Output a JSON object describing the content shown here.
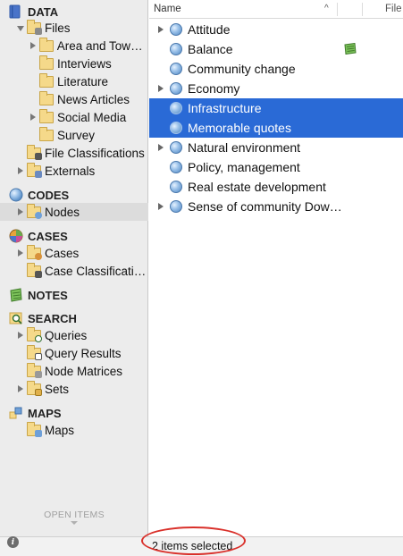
{
  "sidebar": {
    "sections": {
      "data": "DATA",
      "codes": "CODES",
      "cases": "CASES",
      "notes": "NOTES",
      "search": "SEARCH",
      "maps": "MAPS"
    },
    "data_items": {
      "files": "Files",
      "area_and_town": "Area and Town…",
      "interviews": "Interviews",
      "literature": "Literature",
      "news_articles": "News Articles",
      "social_media": "Social Media",
      "survey": "Survey",
      "file_classifications": "File Classifications",
      "externals": "Externals"
    },
    "codes_items": {
      "nodes": "Nodes"
    },
    "cases_items": {
      "cases": "Cases",
      "case_classifications": "Case Classificati…"
    },
    "search_items": {
      "queries": "Queries",
      "query_results": "Query Results",
      "node_matrices": "Node Matrices",
      "sets": "Sets"
    },
    "maps_items": {
      "maps": "Maps"
    },
    "open_items": "OPEN ITEMS",
    "info_icon": "i"
  },
  "list": {
    "columns": {
      "name": "Name",
      "sort_indicator": "^",
      "file": "File"
    },
    "rows": [
      {
        "label": "Attitude",
        "expandable": true,
        "selected": false
      },
      {
        "label": "Balance",
        "expandable": false,
        "selected": false,
        "memo": true
      },
      {
        "label": "Community change",
        "expandable": false,
        "selected": false
      },
      {
        "label": "Economy",
        "expandable": true,
        "selected": false
      },
      {
        "label": "Infrastructure",
        "expandable": false,
        "selected": true
      },
      {
        "label": "Memorable quotes",
        "expandable": false,
        "selected": true
      },
      {
        "label": "Natural environment",
        "expandable": true,
        "selected": false
      },
      {
        "label": "Policy, management",
        "expandable": false,
        "selected": false
      },
      {
        "label": "Real estate development",
        "expandable": false,
        "selected": false
      },
      {
        "label": "Sense of community Dow…",
        "expandable": true,
        "selected": false
      }
    ]
  },
  "status": {
    "text": "2 items selected"
  },
  "colors": {
    "selection": "#2a6ad6",
    "sidebar_bg": "#ececec",
    "highlight_ring": "#d9302a"
  }
}
